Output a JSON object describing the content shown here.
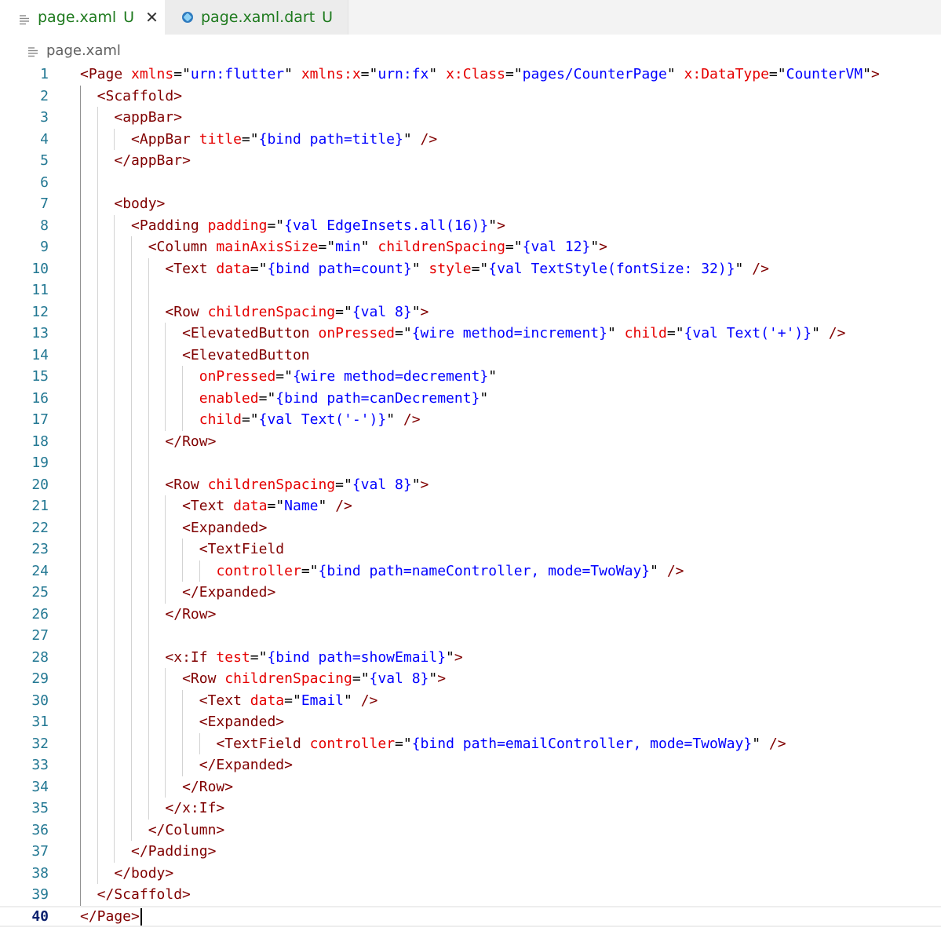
{
  "tabs": [
    {
      "icon": "xml-file-icon",
      "filename": "page.xaml",
      "status": "U",
      "active": true,
      "close_glyph": "✕"
    },
    {
      "icon": "dart-file-icon",
      "filename": "page.xaml.dart",
      "status": "U",
      "active": false
    }
  ],
  "breadcrumb": {
    "icon": "file-lines-icon",
    "filename": "page.xaml"
  },
  "editor": {
    "active_line": 40,
    "lines": [
      {
        "n": "1",
        "indent": 0,
        "text": "<Page xmlns=\"urn:flutter\" xmlns:x=\"urn:fx\" x:Class=\"pages/CounterPage\" x:DataType=\"CounterVM\">"
      },
      {
        "n": "2",
        "indent": 1,
        "text": "<Scaffold>"
      },
      {
        "n": "3",
        "indent": 2,
        "text": "<appBar>"
      },
      {
        "n": "4",
        "indent": 3,
        "text": "<AppBar title=\"{bind path=title}\" />"
      },
      {
        "n": "5",
        "indent": 2,
        "text": "</appBar>"
      },
      {
        "n": "6",
        "indent": 0,
        "text": ""
      },
      {
        "n": "7",
        "indent": 2,
        "text": "<body>"
      },
      {
        "n": "8",
        "indent": 3,
        "text": "<Padding padding=\"{val EdgeInsets.all(16)}\">"
      },
      {
        "n": "9",
        "indent": 4,
        "text": "<Column mainAxisSize=\"min\" childrenSpacing=\"{val 12}\">"
      },
      {
        "n": "10",
        "indent": 5,
        "text": "<Text data=\"{bind path=count}\" style=\"{val TextStyle(fontSize: 32)}\" />"
      },
      {
        "n": "11",
        "indent": 0,
        "text": ""
      },
      {
        "n": "12",
        "indent": 5,
        "text": "<Row childrenSpacing=\"{val 8}\">"
      },
      {
        "n": "13",
        "indent": 6,
        "text": "<ElevatedButton onPressed=\"{wire method=increment}\" child=\"{val Text('+')}\" />"
      },
      {
        "n": "14",
        "indent": 6,
        "text": "<ElevatedButton"
      },
      {
        "n": "15",
        "indent": 7,
        "text": "onPressed=\"{wire method=decrement}\""
      },
      {
        "n": "16",
        "indent": 7,
        "text": "enabled=\"{bind path=canDecrement}\""
      },
      {
        "n": "17",
        "indent": 7,
        "text": "child=\"{val Text('-')}\" />"
      },
      {
        "n": "18",
        "indent": 5,
        "text": "</Row>"
      },
      {
        "n": "19",
        "indent": 0,
        "text": ""
      },
      {
        "n": "20",
        "indent": 5,
        "text": "<Row childrenSpacing=\"{val 8}\">"
      },
      {
        "n": "21",
        "indent": 6,
        "text": "<Text data=\"Name\" />"
      },
      {
        "n": "22",
        "indent": 6,
        "text": "<Expanded>"
      },
      {
        "n": "23",
        "indent": 7,
        "text": "<TextField"
      },
      {
        "n": "24",
        "indent": 8,
        "text": "controller=\"{bind path=nameController, mode=TwoWay}\" />"
      },
      {
        "n": "25",
        "indent": 6,
        "text": "</Expanded>"
      },
      {
        "n": "26",
        "indent": 5,
        "text": "</Row>"
      },
      {
        "n": "27",
        "indent": 0,
        "text": ""
      },
      {
        "n": "28",
        "indent": 5,
        "text": "<x:If test=\"{bind path=showEmail}\">"
      },
      {
        "n": "29",
        "indent": 6,
        "text": "<Row childrenSpacing=\"{val 8}\">"
      },
      {
        "n": "30",
        "indent": 7,
        "text": "<Text data=\"Email\" />"
      },
      {
        "n": "31",
        "indent": 7,
        "text": "<Expanded>"
      },
      {
        "n": "32",
        "indent": 8,
        "text": "<TextField controller=\"{bind path=emailController, mode=TwoWay}\" />"
      },
      {
        "n": "33",
        "indent": 7,
        "text": "</Expanded>"
      },
      {
        "n": "34",
        "indent": 6,
        "text": "</Row>"
      },
      {
        "n": "35",
        "indent": 5,
        "text": "</x:If>"
      },
      {
        "n": "36",
        "indent": 4,
        "text": "</Column>"
      },
      {
        "n": "37",
        "indent": 3,
        "text": "</Padding>"
      },
      {
        "n": "38",
        "indent": 2,
        "text": "</body>"
      },
      {
        "n": "39",
        "indent": 1,
        "text": "</Scaffold>"
      },
      {
        "n": "40",
        "indent": 0,
        "text": "</Page>"
      }
    ]
  },
  "colors": {
    "tag": "#800000",
    "attribute": "#e50000",
    "string": "#0000ff",
    "line_number": "#237893",
    "untracked": "#1e7a1e"
  }
}
